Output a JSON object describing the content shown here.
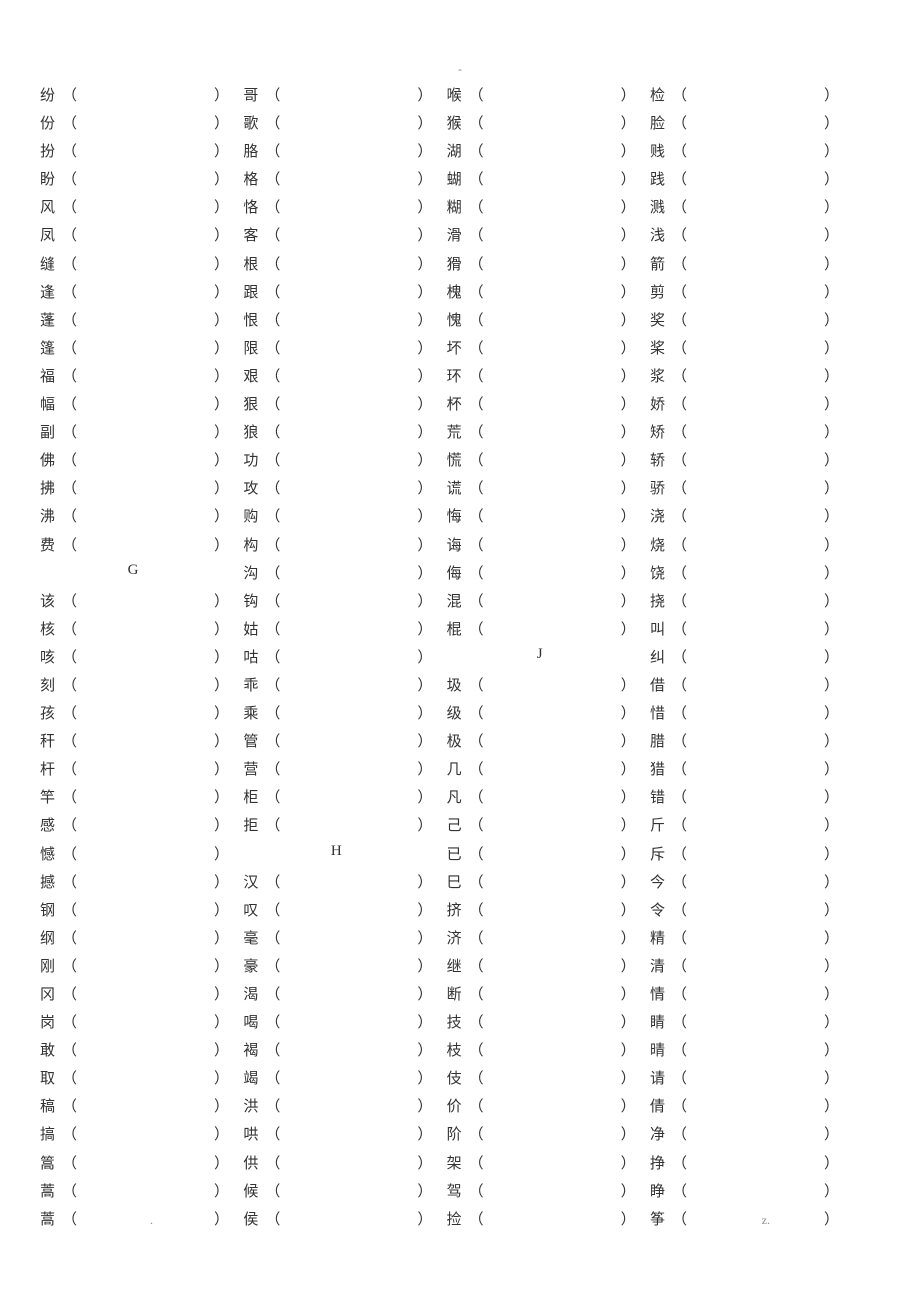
{
  "top_dash": "-",
  "footer_left": ".",
  "footer_right": "z.",
  "header_G": "G",
  "header_H": "H",
  "header_J": "J",
  "columns": [
    [
      {
        "c": "纷"
      },
      {
        "c": "份"
      },
      {
        "c": "扮"
      },
      {
        "c": "盼"
      },
      {
        "c": "风"
      },
      {
        "c": "凤"
      },
      {
        "c": "缝"
      },
      {
        "c": "逢"
      },
      {
        "c": "蓬"
      },
      {
        "c": "篷"
      },
      {
        "c": "福"
      },
      {
        "c": "幅"
      },
      {
        "c": "副"
      },
      {
        "c": "佛"
      },
      {
        "c": "拂"
      },
      {
        "c": "沸"
      },
      {
        "c": "费"
      },
      {
        "header": "G"
      },
      {
        "c": "该"
      },
      {
        "c": "核"
      },
      {
        "c": "咳"
      },
      {
        "c": "刻"
      },
      {
        "c": "孩"
      },
      {
        "c": "秆"
      },
      {
        "c": "杆"
      },
      {
        "c": "竿"
      },
      {
        "c": "感"
      },
      {
        "c": "憾"
      },
      {
        "c": "撼"
      },
      {
        "c": "钢"
      },
      {
        "c": "纲"
      },
      {
        "c": "刚"
      },
      {
        "c": "冈"
      },
      {
        "c": "岗"
      },
      {
        "c": "敢"
      },
      {
        "c": "取"
      },
      {
        "c": "稿"
      },
      {
        "c": "搞"
      },
      {
        "c": "篙"
      },
      {
        "c": "蒿"
      },
      {
        "c": "蒿"
      }
    ],
    [
      {
        "c": "哥"
      },
      {
        "c": "歌"
      },
      {
        "c": "胳"
      },
      {
        "c": "格"
      },
      {
        "c": "恪"
      },
      {
        "c": "客"
      },
      {
        "c": "根"
      },
      {
        "c": "跟"
      },
      {
        "c": "恨"
      },
      {
        "c": "限"
      },
      {
        "c": "艰"
      },
      {
        "c": "狠"
      },
      {
        "c": "狼"
      },
      {
        "c": "功"
      },
      {
        "c": "攻"
      },
      {
        "c": "购"
      },
      {
        "c": "构"
      },
      {
        "c": "沟"
      },
      {
        "c": "钩"
      },
      {
        "c": "姑"
      },
      {
        "c": "咕"
      },
      {
        "c": "乖"
      },
      {
        "c": "乘"
      },
      {
        "c": "管"
      },
      {
        "c": "营"
      },
      {
        "c": "柜"
      },
      {
        "c": "拒"
      },
      {
        "header": "H"
      },
      {
        "c": "汉"
      },
      {
        "c": "叹"
      },
      {
        "c": "毫"
      },
      {
        "c": "豪"
      },
      {
        "c": "渴"
      },
      {
        "c": "喝"
      },
      {
        "c": "褐"
      },
      {
        "c": "竭"
      },
      {
        "c": "洪"
      },
      {
        "c": "哄"
      },
      {
        "c": "供"
      },
      {
        "c": "候"
      },
      {
        "c": "侯"
      }
    ],
    [
      {
        "c": "喉"
      },
      {
        "c": "猴"
      },
      {
        "c": "湖"
      },
      {
        "c": "蝴"
      },
      {
        "c": "糊"
      },
      {
        "c": "滑"
      },
      {
        "c": "猾"
      },
      {
        "c": "槐"
      },
      {
        "c": "愧"
      },
      {
        "c": "坏"
      },
      {
        "c": "环"
      },
      {
        "c": "杯"
      },
      {
        "c": "荒"
      },
      {
        "c": "慌"
      },
      {
        "c": "谎"
      },
      {
        "c": "悔"
      },
      {
        "c": "诲"
      },
      {
        "c": "侮"
      },
      {
        "c": "混"
      },
      {
        "c": "棍"
      },
      {
        "header": "J"
      },
      {
        "c": "圾"
      },
      {
        "c": "级"
      },
      {
        "c": "极"
      },
      {
        "c": "几"
      },
      {
        "c": "凡"
      },
      {
        "c": "己"
      },
      {
        "c": "已"
      },
      {
        "c": "巳"
      },
      {
        "c": "挤"
      },
      {
        "c": "济"
      },
      {
        "c": "继"
      },
      {
        "c": "断"
      },
      {
        "c": "技"
      },
      {
        "c": "枝"
      },
      {
        "c": "伎"
      },
      {
        "c": "价"
      },
      {
        "c": "阶"
      },
      {
        "c": "架"
      },
      {
        "c": "驾"
      },
      {
        "c": "捡"
      }
    ],
    [
      {
        "c": "检"
      },
      {
        "c": "脸"
      },
      {
        "c": "贱"
      },
      {
        "c": "践"
      },
      {
        "c": "溅"
      },
      {
        "c": "浅"
      },
      {
        "c": "箭"
      },
      {
        "c": "剪"
      },
      {
        "c": "奖"
      },
      {
        "c": "桨"
      },
      {
        "c": "浆"
      },
      {
        "c": "娇"
      },
      {
        "c": "矫"
      },
      {
        "c": "轿"
      },
      {
        "c": "骄"
      },
      {
        "c": "浇"
      },
      {
        "c": "烧"
      },
      {
        "c": "饶"
      },
      {
        "c": "挠"
      },
      {
        "c": "叫"
      },
      {
        "c": "纠"
      },
      {
        "c": "借"
      },
      {
        "c": "惜"
      },
      {
        "c": "腊"
      },
      {
        "c": "猎"
      },
      {
        "c": "错"
      },
      {
        "c": "斤"
      },
      {
        "c": "斥"
      },
      {
        "c": "今"
      },
      {
        "c": "令"
      },
      {
        "c": "精"
      },
      {
        "c": "清"
      },
      {
        "c": "情"
      },
      {
        "c": "睛"
      },
      {
        "c": "晴"
      },
      {
        "c": "请"
      },
      {
        "c": "倩"
      },
      {
        "c": "净"
      },
      {
        "c": "挣"
      },
      {
        "c": "睁"
      },
      {
        "c": "筝"
      }
    ]
  ]
}
